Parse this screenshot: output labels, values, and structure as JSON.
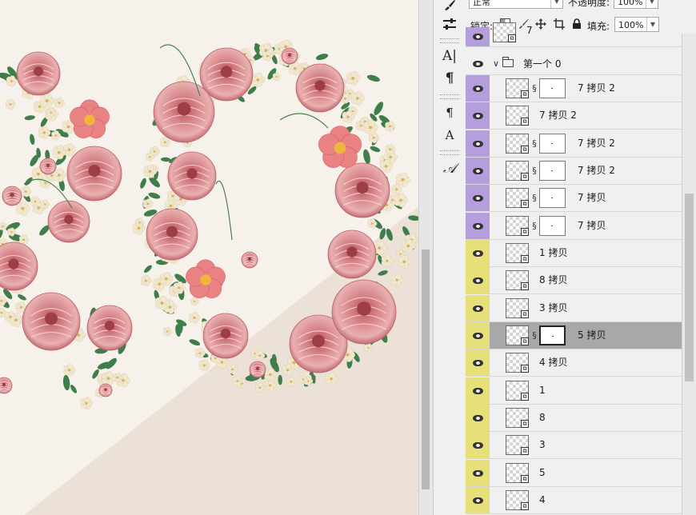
{
  "colors": {
    "canvas_bg": "#f7f1ec",
    "canvas_diagonal": "#ebe1d7",
    "label_purple": "#b49fdc",
    "label_yellow": "#e6df7a",
    "selected_row": "#a8a8a8"
  },
  "options": {
    "blend_mode": "正常",
    "opacity_label": "不透明度:",
    "opacity_value": "100%",
    "lock_label": "锁定:",
    "fill_label": "填充:",
    "fill_value": "100%"
  },
  "tools": [
    {
      "icon": "brush-icon"
    },
    {
      "icon": "adjust-sliders-icon"
    },
    {
      "icon": "character-panel-icon",
      "glyph": "A|"
    },
    {
      "icon": "paragraph-icon",
      "glyph": "¶"
    },
    {
      "icon": "paragraph-styles-icon",
      "glyph": "¶"
    },
    {
      "icon": "character-styles-icon",
      "glyph": "A"
    },
    {
      "icon": "glyph-icon",
      "glyph": "𝒜"
    }
  ],
  "layers": [
    {
      "name": "7",
      "label": "purple",
      "mask": false,
      "group": false
    },
    {
      "name": "第一个 0",
      "label": "none",
      "mask": false,
      "group": true
    },
    {
      "name": "7 拷贝 2",
      "label": "purple",
      "mask": true
    },
    {
      "name": "7 拷贝 2",
      "label": "purple",
      "mask": false
    },
    {
      "name": "7 拷贝 2",
      "label": "purple",
      "mask": true
    },
    {
      "name": "7 拷贝 2",
      "label": "purple",
      "mask": true
    },
    {
      "name": "7 拷贝",
      "label": "purple",
      "mask": true
    },
    {
      "name": "7 拷贝",
      "label": "purple",
      "mask": true
    },
    {
      "name": "1 拷贝",
      "label": "yellow",
      "mask": false
    },
    {
      "name": "8 拷贝",
      "label": "yellow",
      "mask": false
    },
    {
      "name": "3 拷贝",
      "label": "yellow",
      "mask": false
    },
    {
      "name": "5 拷贝",
      "label": "yellow",
      "mask": true,
      "selected": true
    },
    {
      "name": "4 拷贝",
      "label": "yellow",
      "mask": false
    },
    {
      "name": "1",
      "label": "yellow",
      "mask": false
    },
    {
      "name": "8",
      "label": "yellow",
      "mask": false
    },
    {
      "name": "3",
      "label": "yellow",
      "mask": false
    },
    {
      "name": "5",
      "label": "yellow",
      "mask": false
    },
    {
      "name": "4",
      "label": "yellow",
      "mask": false
    }
  ]
}
